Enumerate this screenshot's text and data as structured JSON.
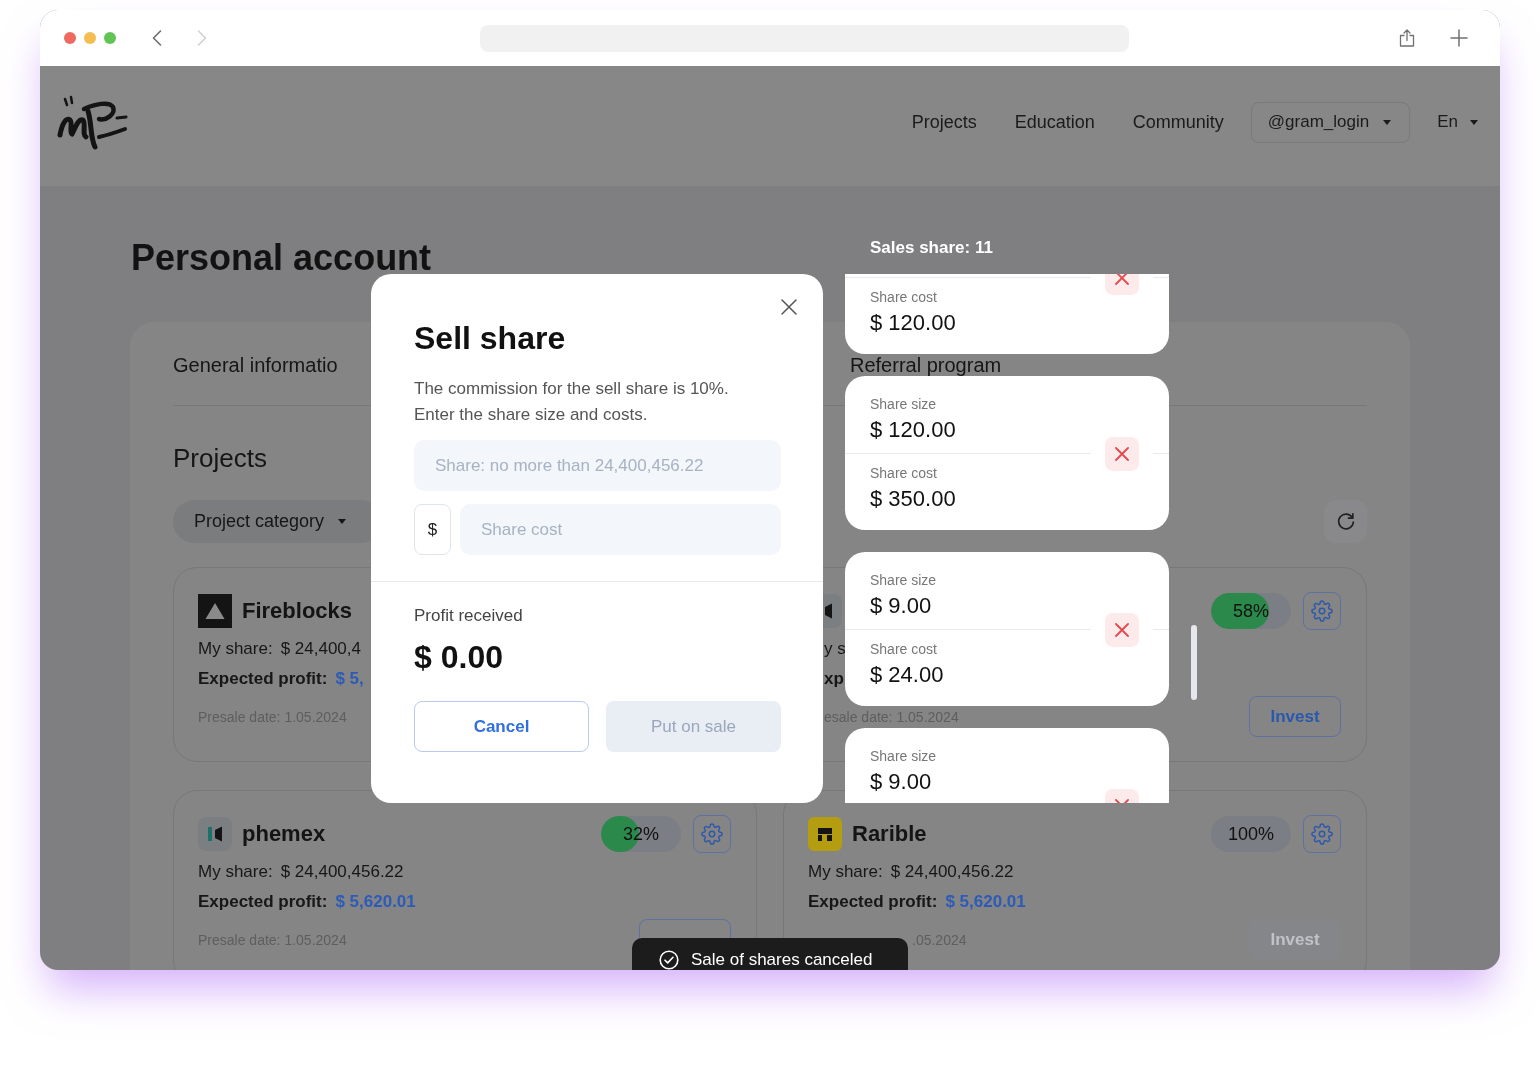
{
  "browser": {
    "back": {
      "disabled": false
    },
    "forward": {
      "disabled": true
    }
  },
  "header": {
    "nav": [
      "Projects",
      "Education",
      "Community"
    ],
    "account": "@gram_login",
    "language": "En"
  },
  "page": {
    "title": "Personal account",
    "tabs": [
      "General informatio",
      "Referral program"
    ]
  },
  "projects": {
    "title": "Projects",
    "filter": "Project category",
    "items": [
      {
        "kind": "card",
        "name": "Fireblocks",
        "my_share_label": "My share:",
        "my_share": "$ 24,400,4",
        "profit_label": "Expected profit:",
        "profit": "$ 5,",
        "presale": "Presale date: 1.05.2024"
      },
      {
        "kind": "behind_panel",
        "progress": {
          "text": "58%",
          "level": 0.72
        },
        "my_share_label": "y s",
        "profit_label": "xp",
        "presale": "esale date: 1.05.2024",
        "invest": {
          "label": "Invest",
          "disabled": false
        }
      },
      {
        "kind": "card",
        "name": "phemex",
        "progress": {
          "text": "32%",
          "level": 0.47
        },
        "my_share_label": "My share:",
        "my_share": "$ 24,400,456.22",
        "profit_label": "Expected profit:",
        "profit": "$ 5,620.01",
        "presale": "Presale date: 1.05.2024",
        "invest": {
          "disabled": false
        }
      },
      {
        "kind": "behind_toast",
        "name": "Rarible",
        "progress": {
          "text": "100%"
        },
        "my_share_label": "My share:",
        "my_share": "$ 24,400,456.22",
        "profit_label": "Expected profit:",
        "profit": "$ 5,620.01",
        "presale": ".05.2024",
        "invest": {
          "label": "Invest",
          "disabled": true
        }
      }
    ]
  },
  "sales_panel": {
    "title": "Sales share: 11",
    "items": [
      {
        "cost_label": "Share cost",
        "cost": "$ 120.00"
      },
      {
        "size_label": "Share size",
        "size": "$ 120.00",
        "cost_label": "Share cost",
        "cost": "$ 350.00"
      },
      {
        "size_label": "Share size",
        "size": "$ 9.00",
        "cost_label": "Share cost",
        "cost": "$ 24.00"
      },
      {
        "size_label": "Share size",
        "size": "$ 9.00"
      }
    ]
  },
  "modal": {
    "title": "Sell share",
    "description": [
      "The commission for the sell share is 10%.",
      "Enter the share size and costs."
    ],
    "share_field": {
      "placeholder": "Share: no more than 24,400,456.22"
    },
    "currency": "$",
    "cost_field": {
      "placeholder": "Share cost"
    },
    "profit_label": "Profit received",
    "profit": "$ 0.00",
    "buttons": [
      {
        "label": "Cancel",
        "kind": "secondary",
        "disabled": false
      },
      {
        "label": "Put on sale",
        "kind": "primary",
        "disabled": true
      }
    ]
  },
  "toast": {
    "text": "Sale of shares canceled"
  }
}
